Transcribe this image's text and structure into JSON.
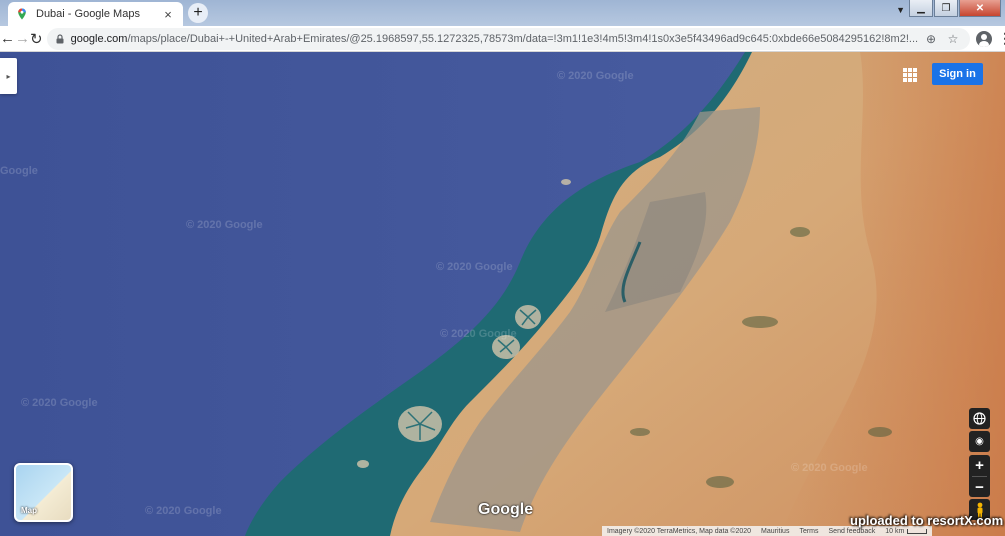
{
  "browser": {
    "tab_title": "Dubai - Google Maps",
    "tab_close": "×",
    "new_tab": "+",
    "window_min": "▁",
    "window_max": "❐",
    "window_close": "✕",
    "url_host": "google.com",
    "url_path": "/maps/place/Dubai+-+United+Arab+Emirates/@25.1968597,55.1272325,78573m/data=!3m1!1e3!4m5!3m4!1s0x3e5f43496ad9c645:0xbde66e5084295162!8m2!...",
    "back": "←",
    "forward": "→",
    "reload": "↻",
    "bookmark_star": "☆",
    "add_icon": "⊕",
    "menu": "⋮"
  },
  "map": {
    "watermarks": [
      "© 2020 Google",
      "Google",
      "© 2020 Google",
      "© 2020 Google",
      "© 2020 Google",
      "© 2020 Google",
      "© 2020 Google",
      "© 2020 Google"
    ],
    "side_toggle": "▸",
    "sign_in": "Sign in",
    "layer_label": "Map",
    "google_logo": "Google",
    "controls": {
      "globe": "🌐",
      "locate": "◉",
      "zoom_in": "+",
      "zoom_out": "−"
    },
    "attribution": {
      "imagery": "Imagery ©2020 TerraMetrics, Map data ©2020",
      "country": "Mauritius",
      "terms": "Terms",
      "feedback": "Send feedback",
      "scale": "10 km"
    },
    "upload_watermark": "uploaded to resortX.com"
  }
}
